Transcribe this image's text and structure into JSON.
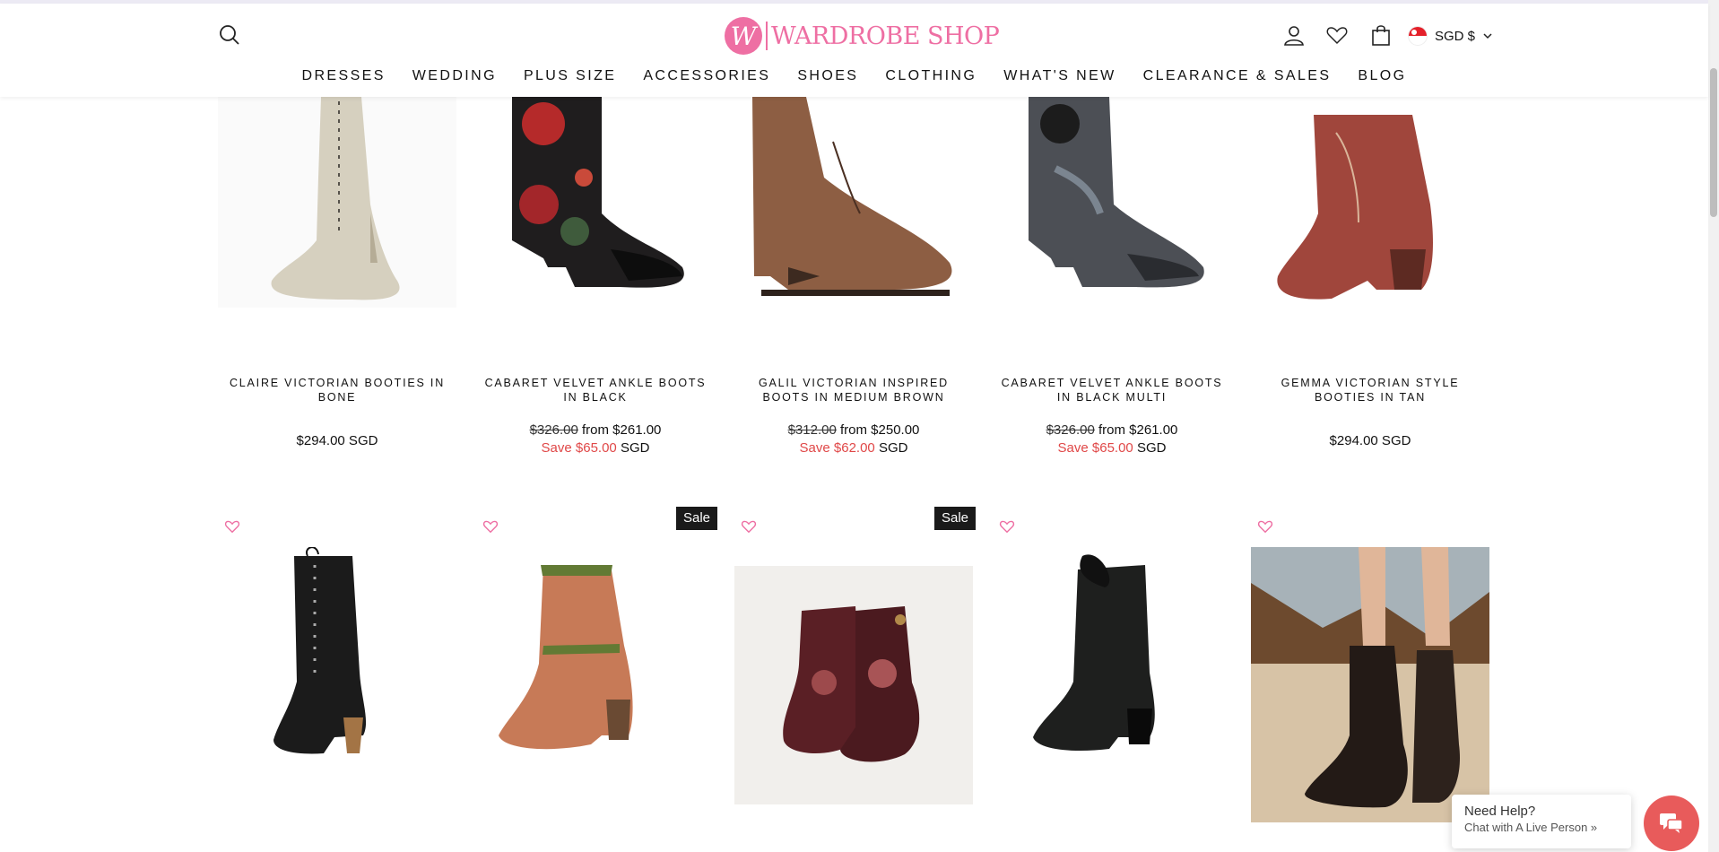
{
  "header": {
    "logo_letter": "W",
    "logo_text": "WARDROBE SHOP",
    "currency": "SGD $"
  },
  "nav": [
    "DRESSES",
    "WEDDING",
    "PLUS SIZE",
    "ACCESSORIES",
    "SHOES",
    "CLOTHING",
    "WHAT'S NEW",
    "CLEARANCE & SALES",
    "BLOG"
  ],
  "row1": [
    {
      "name": "CLAIRE VICTORIAN BOOTIES IN BONE",
      "price": "$294.00 SGD"
    },
    {
      "name": "CABARET VELVET ANKLE BOOTS IN BLACK",
      "old_price": "$326.00",
      "from_price": "from $261.00",
      "save": "Save $65.00",
      "currency": "SGD"
    },
    {
      "name": "GALIL VICTORIAN INSPIRED BOOTS IN MEDIUM BROWN",
      "old_price": "$312.00",
      "from_price": "from $250.00",
      "save": "Save $62.00",
      "currency": "SGD"
    },
    {
      "name": "CABARET VELVET ANKLE BOOTS IN BLACK MULTI",
      "old_price": "$326.00",
      "from_price": "from $261.00",
      "save": "Save $65.00",
      "currency": "SGD"
    },
    {
      "name": "GEMMA VICTORIAN STYLE BOOTIES IN TAN",
      "price": "$294.00 SGD"
    }
  ],
  "row2": [
    {
      "sale": ""
    },
    {
      "sale": "Sale"
    },
    {
      "sale": "Sale"
    },
    {
      "sale": ""
    },
    {
      "sale": ""
    }
  ],
  "chat": {
    "title": "Need Help?",
    "subtitle": "Chat with A Live Person »"
  },
  "colors": {
    "brand_pink": "#ee6fa3",
    "sale_red": "#e04848",
    "chat_red": "#e85b5b"
  },
  "icons": [
    "search-icon",
    "account-icon",
    "heart-icon",
    "bag-icon",
    "chevron-down-icon",
    "chat-icon"
  ]
}
